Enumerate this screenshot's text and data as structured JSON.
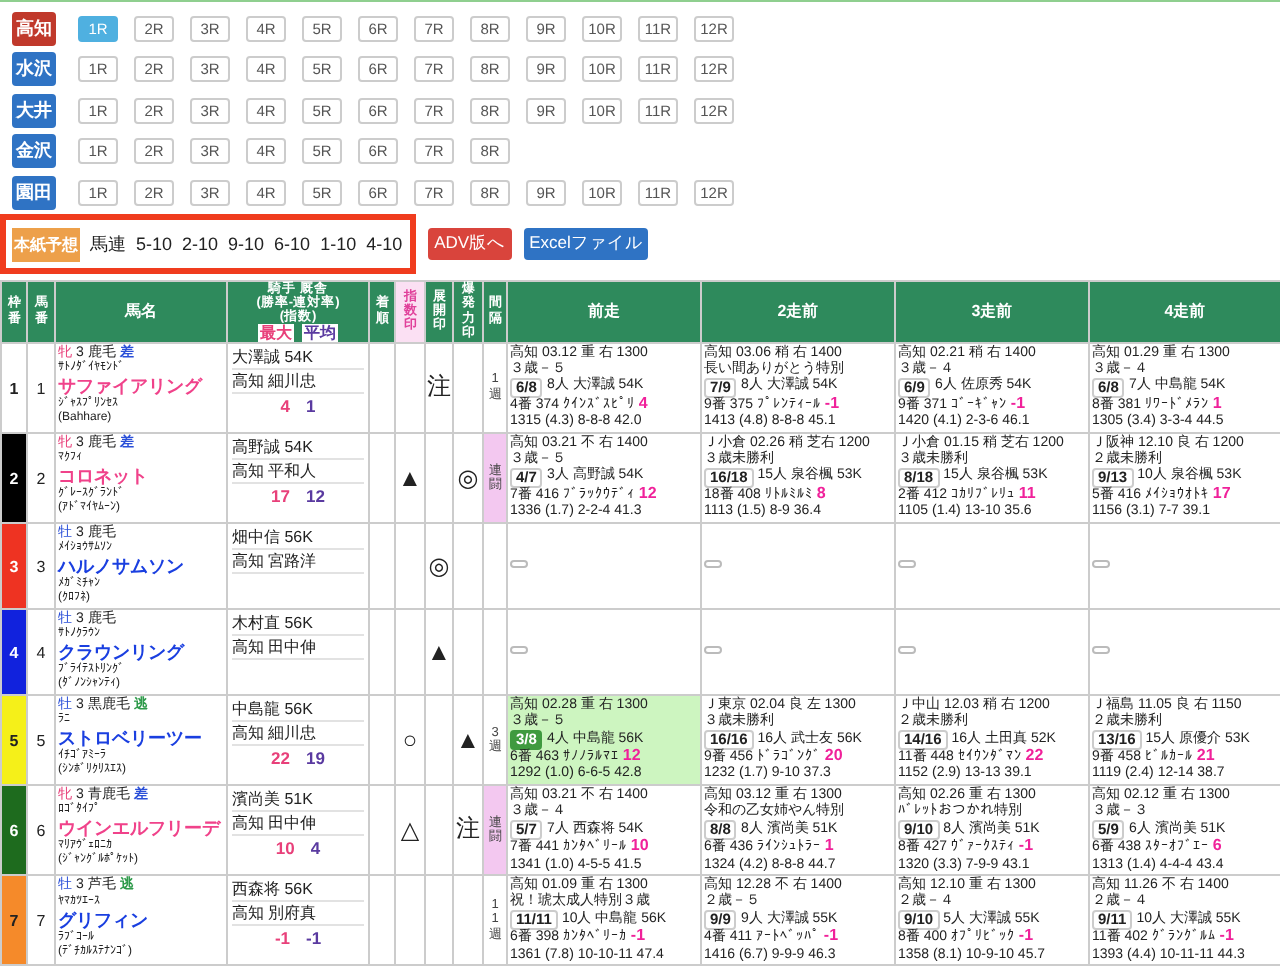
{
  "venues": [
    {
      "label": "高知",
      "selected": true,
      "races": [
        {
          "label": "1R",
          "selected": true
        },
        {
          "label": "2R",
          "selected": false
        },
        {
          "label": "3R",
          "selected": false
        },
        {
          "label": "4R",
          "selected": false
        },
        {
          "label": "5R",
          "selected": false
        },
        {
          "label": "6R",
          "selected": false
        },
        {
          "label": "7R",
          "selected": false
        },
        {
          "label": "8R",
          "selected": false
        },
        {
          "label": "9R",
          "selected": false
        },
        {
          "label": "10R",
          "selected": false
        },
        {
          "label": "11R",
          "selected": false
        },
        {
          "label": "12R",
          "selected": false
        }
      ]
    },
    {
      "label": "水沢",
      "selected": false,
      "races": [
        {
          "label": "1R",
          "selected": false
        },
        {
          "label": "2R",
          "selected": false
        },
        {
          "label": "3R",
          "selected": false
        },
        {
          "label": "4R",
          "selected": false
        },
        {
          "label": "5R",
          "selected": false
        },
        {
          "label": "6R",
          "selected": false
        },
        {
          "label": "7R",
          "selected": false
        },
        {
          "label": "8R",
          "selected": false
        },
        {
          "label": "9R",
          "selected": false
        },
        {
          "label": "10R",
          "selected": false
        },
        {
          "label": "11R",
          "selected": false
        },
        {
          "label": "12R",
          "selected": false
        }
      ]
    },
    {
      "label": "大井",
      "selected": false,
      "races": [
        {
          "label": "1R",
          "selected": false
        },
        {
          "label": "2R",
          "selected": false
        },
        {
          "label": "3R",
          "selected": false
        },
        {
          "label": "4R",
          "selected": false
        },
        {
          "label": "5R",
          "selected": false
        },
        {
          "label": "6R",
          "selected": false
        },
        {
          "label": "7R",
          "selected": false
        },
        {
          "label": "8R",
          "selected": false
        },
        {
          "label": "9R",
          "selected": false
        },
        {
          "label": "10R",
          "selected": false
        },
        {
          "label": "11R",
          "selected": false
        },
        {
          "label": "12R",
          "selected": false
        }
      ]
    },
    {
      "label": "金沢",
      "selected": false,
      "races": [
        {
          "label": "1R",
          "selected": false
        },
        {
          "label": "2R",
          "selected": false
        },
        {
          "label": "3R",
          "selected": false
        },
        {
          "label": "4R",
          "selected": false
        },
        {
          "label": "5R",
          "selected": false
        },
        {
          "label": "6R",
          "selected": false
        },
        {
          "label": "7R",
          "selected": false
        },
        {
          "label": "8R",
          "selected": false
        }
      ]
    },
    {
      "label": "園田",
      "selected": false,
      "races": [
        {
          "label": "1R",
          "selected": false
        },
        {
          "label": "2R",
          "selected": false
        },
        {
          "label": "3R",
          "selected": false
        },
        {
          "label": "4R",
          "selected": false
        },
        {
          "label": "5R",
          "selected": false
        },
        {
          "label": "6R",
          "selected": false
        },
        {
          "label": "7R",
          "selected": false
        },
        {
          "label": "8R",
          "selected": false
        },
        {
          "label": "9R",
          "selected": false
        },
        {
          "label": "10R",
          "selected": false
        },
        {
          "label": "11R",
          "selected": false
        },
        {
          "label": "12R",
          "selected": false
        }
      ]
    }
  ],
  "prediction": {
    "label": "本紙予想",
    "bet_type": "馬連",
    "combos": [
      "5-10",
      "2-10",
      "9-10",
      "6-10",
      "1-10",
      "4-10"
    ],
    "highlighted": true
  },
  "buttons": [
    {
      "label": "ADV版へ",
      "color": "#d9443c"
    },
    {
      "label": "Excelファイル",
      "color": "#2f73c4"
    }
  ],
  "table": {
    "columns": [
      {
        "kind": "vertical",
        "label": "枠番",
        "highlighted": false
      },
      {
        "kind": "vertical",
        "label": "馬番",
        "highlighted": false
      },
      {
        "kind": "plain",
        "label": "馬名",
        "highlighted": false
      },
      {
        "kind": "jockey",
        "label": "騎手 厩舎",
        "lines": [
          "(勝率-連対率)",
          "(指数)"
        ],
        "legend": [
          {
            "label": "最大",
            "color": "#e8407a"
          },
          {
            "label": "平均",
            "color": "#5a3aa0"
          }
        ],
        "highlighted": false
      },
      {
        "kind": "vertical",
        "label": "着順",
        "highlighted": false
      },
      {
        "kind": "vertical",
        "label": "指数印",
        "highlighted": true
      },
      {
        "kind": "vertical",
        "label": "展開印",
        "highlighted": false
      },
      {
        "kind": "vertical",
        "label": "爆発力印",
        "highlighted": false
      },
      {
        "kind": "vertical",
        "label": "間隔",
        "highlighted": false
      },
      {
        "kind": "plain",
        "label": "前走",
        "highlighted": false
      },
      {
        "kind": "plain",
        "label": "2走前",
        "highlighted": false
      },
      {
        "kind": "plain",
        "label": "3走前",
        "highlighted": false
      },
      {
        "kind": "plain",
        "label": "4走前",
        "highlighted": false
      }
    ],
    "rows": [
      {
        "frame": "1",
        "color": "#ffffff",
        "number": "1",
        "horse": {
          "sex": "牝",
          "female": true,
          "age": "3",
          "coat": "鹿毛",
          "style": {
            "text": "差",
            "color": "#2a4fd8"
          },
          "sire": "ｻﾄﾉﾀﾞｲﾔﾓﾝﾄﾞ",
          "name": "サファイアリング",
          "dam": "ｼﾞｬｽﾌﾟﾘﾝｾｽ",
          "dam_sire": "(Bahhare)"
        },
        "jockey": "大澤誠 54K",
        "trainer": "高知 細川忠",
        "index_max": "4",
        "index_avg": "1",
        "marks": {
          "tenkai": "注"
        },
        "interval": {
          "text": "1週",
          "highlighted": false
        },
        "past": [
          {
            "kind": "race",
            "won": false,
            "info": "高知 03.12 重 右 1300",
            "race_name": "３歳－５",
            "finish": "6/8",
            "detail": "8人 大澤誠 54K",
            "horse_detail": "4番 374 ｸｲﾝｽﾞｽﾋﾟﾘ",
            "index": "4",
            "time": "1315 (4.3) 8-8-8 42.0"
          },
          {
            "kind": "race",
            "won": false,
            "info": "高知 03.06 稍 右 1400",
            "race_name": "長い間ありがとう特別",
            "finish": "7/9",
            "detail": "8人 大澤誠 54K",
            "horse_detail": "9番 375 ﾌﾟﾚﾝﾃｨｰﾙ",
            "index": "-1",
            "time": "1413 (4.8) 8-8-8 45.1"
          },
          {
            "kind": "race",
            "won": false,
            "info": "高知 02.21 稍 右 1400",
            "race_name": "３歳－４",
            "finish": "6/9",
            "detail": "6人 佐原秀 54K",
            "horse_detail": "9番 371 ｺﾞｰｷﾞｬﾝ",
            "index": "-1",
            "time": "1420 (4.1) 2-3-6 46.1"
          },
          {
            "kind": "race",
            "won": false,
            "info": "高知 01.29 重 右 1300",
            "race_name": "３歳－４",
            "finish": "6/8",
            "detail": "7人 中島龍 54K",
            "horse_detail": "8番 381 ﾘﾜｰﾄﾞﾒﾗﾝ",
            "index": "1",
            "time": "1305 (3.4) 3-3-4 44.5"
          }
        ]
      },
      {
        "frame": "2",
        "color": "#000000",
        "number": "2",
        "horse": {
          "sex": "牝",
          "female": true,
          "age": "3",
          "coat": "鹿毛",
          "style": {
            "text": "差",
            "color": "#2a4fd8"
          },
          "sire": "ﾏｸﾌｨ",
          "name": "コロネット",
          "dam": "ｸﾞﾚｰｽｸﾞﾗﾝﾄﾞ",
          "dam_sire": "(ｱﾄﾞﾏｲﾔﾑｰﾝ)"
        },
        "jockey": "高野誠 54K",
        "trainer": "高知 平和人",
        "index_max": "17",
        "index_avg": "12",
        "marks": {
          "index": "▲",
          "burst": "◎"
        },
        "interval": {
          "text": "連闘",
          "highlighted": true
        },
        "past": [
          {
            "kind": "race",
            "won": false,
            "info": "高知 03.21 不 右 1400",
            "race_name": "３歳－５",
            "finish": "4/7",
            "detail": "3人 高野誠 54K",
            "horse_detail": "7番 416 ﾌﾞﾗｯｸｳﾃﾞｨ",
            "index": "12",
            "time": "1336 (1.7) 2-2-4 41.3"
          },
          {
            "kind": "race",
            "won": false,
            "info": "Ｊ小倉 02.26 稍 芝右 1200",
            "race_name": "３歳未勝利",
            "finish": "16/18",
            "detail": "15人 泉谷楓 53K",
            "horse_detail": "18番 408 ﾘﾄﾙﾐﾙﾐ",
            "index": "8",
            "time": "1113 (1.5) 8-9 36.4"
          },
          {
            "kind": "race",
            "won": false,
            "info": "Ｊ小倉 01.15 稍 芝右 1200",
            "race_name": "３歳未勝利",
            "finish": "8/18",
            "detail": "15人 泉谷楓 53K",
            "horse_detail": "2番 412 ｺｶﾘﾌﾞﾚﾘｭ",
            "index": "11",
            "time": "1105 (1.4) 13-10 35.6"
          },
          {
            "kind": "race",
            "won": false,
            "info": "Ｊ阪神 12.10 良 右 1200",
            "race_name": "２歳未勝利",
            "finish": "9/13",
            "detail": "10人 泉谷楓 53K",
            "horse_detail": "5番 416 ﾒｲｼｮｳｵﾄｷ",
            "index": "17",
            "time": "1156 (3.1) 7-7 39.1"
          }
        ]
      },
      {
        "frame": "3",
        "color": "#ee3322",
        "number": "3",
        "horse": {
          "sex": "牡",
          "female": false,
          "age": "3",
          "coat": "鹿毛",
          "sire": "ﾒｲｼｮｳｻﾑｿﾝ",
          "name": "ハルノサムソン",
          "dam": "ﾒｶﾞﾐﾁｬﾝ",
          "dam_sire": "(ｸﾛﾌﾈ)"
        },
        "jockey": "畑中信 56K",
        "trainer": "高知 宮路洋",
        "marks": {
          "tenkai": "◎"
        },
        "past": [
          {
            "kind": "empty"
          },
          {
            "kind": "empty"
          },
          {
            "kind": "empty"
          },
          {
            "kind": "empty"
          }
        ]
      },
      {
        "frame": "4",
        "color": "#1122dd",
        "number": "4",
        "horse": {
          "sex": "牡",
          "female": false,
          "age": "3",
          "coat": "鹿毛",
          "sire": "ｻﾄﾉｸﾗｳﾝ",
          "name": "クラウンリング",
          "dam": "ﾌﾞﾗｲﾃｽﾄﾘﾝｸﾞ",
          "dam_sire": "(ﾀﾞﾉﾝｼｬﾝﾃｨ)"
        },
        "jockey": "木村直 56K",
        "trainer": "高知 田中伸",
        "marks": {
          "tenkai": "▲"
        },
        "past": [
          {
            "kind": "empty"
          },
          {
            "kind": "empty"
          },
          {
            "kind": "empty"
          },
          {
            "kind": "empty"
          }
        ]
      },
      {
        "frame": "5",
        "color": "#f5f019",
        "number": "5",
        "horse": {
          "sex": "牡",
          "female": false,
          "age": "3",
          "coat": "黒鹿毛",
          "style": {
            "text": "逃",
            "color": "#2e9a4a"
          },
          "sire": "ﾗﾆ",
          "name": "ストロベリーツー",
          "dam": "ｲﾁｺﾞｱﾐｰﾗ",
          "dam_sire": "(ｼﾝﾎﾞﾘｸﾘｽｴｽ)"
        },
        "jockey": "中島龍 56K",
        "trainer": "高知 細川忠",
        "index_max": "22",
        "index_avg": "19",
        "marks": {
          "index": "○",
          "burst": "▲"
        },
        "interval": {
          "text": "3週",
          "highlighted": false
        },
        "past": [
          {
            "kind": "race",
            "won": true,
            "info": "高知 02.28 重 右 1300",
            "race_name": "３歳－５",
            "finish": "3/8",
            "detail": "4人 中島龍 56K",
            "horse_detail": "6番 463 ｻﾉﾉﾗﾙﾏｴ",
            "index": "12",
            "time": "1292 (1.0) 6-6-5 42.8"
          },
          {
            "kind": "race",
            "won": false,
            "info": "Ｊ東京 02.04 良 左 1300",
            "race_name": "３歳未勝利",
            "finish": "16/16",
            "detail": "16人 武士友 56K",
            "horse_detail": "9番 456 ﾄﾞﾗｺﾞﾝｸﾞ",
            "index": "20",
            "time": "1232 (1.7) 9-10 37.3"
          },
          {
            "kind": "race",
            "won": false,
            "info": "Ｊ中山 12.03 稍 右 1200",
            "race_name": "２歳未勝利",
            "finish": "14/16",
            "detail": "16人 土田真 52K",
            "horse_detail": "11番 448 ｾｲｳﾝﾀﾞﾏﾝ",
            "index": "22",
            "time": "1152 (2.9) 13-13 39.1"
          },
          {
            "kind": "race",
            "won": false,
            "info": "Ｊ福島 11.05 良 右 1150",
            "race_name": "２歳未勝利",
            "finish": "13/16",
            "detail": "15人 原優介 53K",
            "horse_detail": "9番 458 ﾋﾞﾙｶｰﾙ",
            "index": "21",
            "time": "1119 (2.4) 12-14 38.7"
          }
        ]
      },
      {
        "frame": "6",
        "color": "#1e6b1e",
        "number": "6",
        "horse": {
          "sex": "牝",
          "female": true,
          "age": "3",
          "coat": "青鹿毛",
          "style": {
            "text": "差",
            "color": "#2a4fd8"
          },
          "sire": "ﾛｺﾞﾀｲﾌﾟ",
          "name": "ウインエルフリーデ",
          "dam": "ﾏﾘｱｳﾞｪﾛﾆｶ",
          "dam_sire": "(ｼﾞｬﾝｸﾞﾙﾎﾟｹｯﾄ)"
        },
        "jockey": "濱尚美 51K",
        "trainer": "高知 田中伸",
        "index_max": "10",
        "index_avg": "4",
        "marks": {
          "index": "△",
          "burst": "注"
        },
        "interval": {
          "text": "連闘",
          "highlighted": true
        },
        "past": [
          {
            "kind": "race",
            "won": false,
            "info": "高知 03.21 不 右 1400",
            "race_name": "３歳－４",
            "finish": "5/7",
            "detail": "7人 西森将 54K",
            "horse_detail": "7番 441 ｶﾝﾀﾍﾞﾘｰﾙ",
            "index": "10",
            "time": "1341 (1.0) 4-5-5 41.5"
          },
          {
            "kind": "race",
            "won": false,
            "info": "高知 03.12 重 右 1300",
            "race_name": "令和の乙女姉やん特別",
            "finish": "8/8",
            "detail": "8人 濱尚美 51K",
            "horse_detail": "6番 436 ﾗｲﾝｼｭﾄﾗｰ",
            "index": "1",
            "time": "1324 (4.2) 8-8-8 44.7"
          },
          {
            "kind": "race",
            "won": false,
            "info": "高知 02.26 重 右 1300",
            "race_name": "ﾊﾞﾚｯﾄおつかれ特別",
            "finish": "9/10",
            "detail": "8人 濱尚美 51K",
            "horse_detail": "8番 427 ｳﾞｧｰｸｽﾃｨ",
            "index": "-1",
            "time": "1320 (3.3) 7-9-9 43.1"
          },
          {
            "kind": "race",
            "won": false,
            "info": "高知 02.12 重 右 1300",
            "race_name": "３歳－３",
            "finish": "5/9",
            "detail": "6人 濱尚美 51K",
            "horse_detail": "6番 438 ｽﾀｰｵﾌﾞｴｰ",
            "index": "6",
            "time": "1313 (1.4) 4-4-4 43.4"
          }
        ]
      },
      {
        "frame": "7",
        "color": "#f58a2a",
        "number": "7",
        "horse": {
          "sex": "牡",
          "female": false,
          "age": "3",
          "coat": "芦毛",
          "style": {
            "text": "逃",
            "color": "#2e9a4a"
          },
          "sire": "ﾔﾏｶﾂｴｰｽ",
          "name": "グリフィン",
          "dam": "ﾗﾌﾞｺｰﾙ",
          "dam_sire": "(ﾃﾞﾁｶﾙｽﾃﾅﾝｺﾞ)"
        },
        "jockey": "西森将 56K",
        "trainer": "高知 別府真",
        "index_max": "-1",
        "index_avg": "-1",
        "interval": {
          "text": "11週",
          "highlighted": false
        },
        "past": [
          {
            "kind": "race",
            "won": false,
            "info": "高知 01.09 重 右 1300",
            "race_name": "祝！琥太成人特別３歳",
            "finish": "11/11",
            "detail": "10人 中島龍 56K",
            "horse_detail": "6番 398 ｶﾝﾀﾍﾞﾘｰｶ",
            "index": "-1",
            "time": "1361 (7.8) 10-10-11 47.4"
          },
          {
            "kind": "race",
            "won": false,
            "info": "高知 12.28 不 右 1400",
            "race_name": "２歳－５",
            "finish": "9/9",
            "detail": "9人 大澤誠 55K",
            "horse_detail": "4番 411 ｱｰﾄﾍﾞｯﾊﾟ",
            "index": "-1",
            "time": "1416 (6.7) 9-9-9 46.3"
          },
          {
            "kind": "race",
            "won": false,
            "info": "高知 12.10 重 右 1300",
            "race_name": "２歳－４",
            "finish": "9/10",
            "detail": "5人 大澤誠 55K",
            "horse_detail": "8番 400 ｵﾌﾟﾘﾋﾞｯｸ",
            "index": "-1",
            "time": "1358 (8.1) 10-9-10 45.7"
          },
          {
            "kind": "race",
            "won": false,
            "info": "高知 11.26 不 右 1400",
            "race_name": "２歳－４",
            "finish": "9/11",
            "detail": "10人 大澤誠 55K",
            "horse_detail": "11番 402 ｸﾞﾗﾝｸﾞﾙﾑ",
            "index": "-1",
            "time": "1393 (4.4) 10-11-11 44.3"
          }
        ]
      }
    ]
  }
}
